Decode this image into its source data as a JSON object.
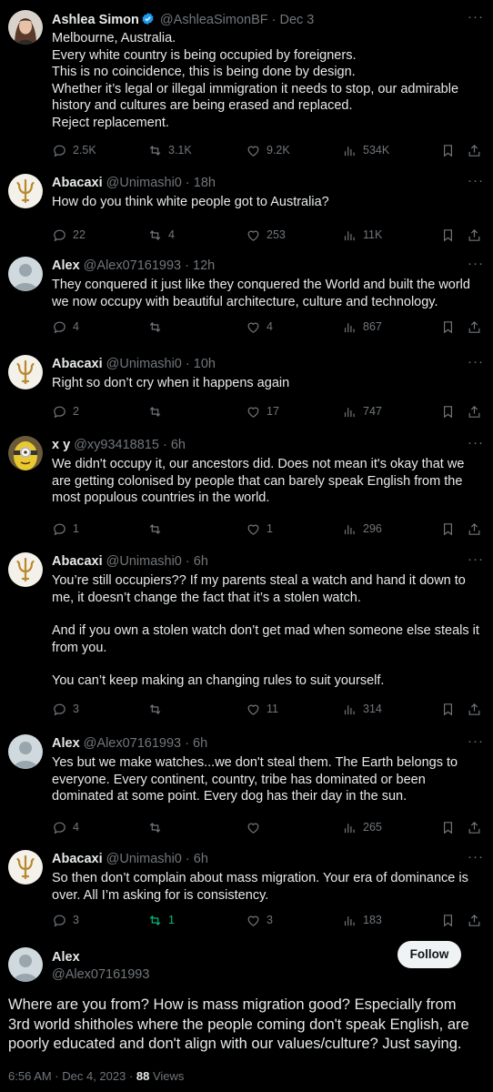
{
  "tweets": [
    {
      "name": "Ashlea Simon",
      "verified": true,
      "handle": "@AshleaSimonBF",
      "time": "· Dec 3",
      "avatar": "woman-photo",
      "paragraphs": [
        "Melbourne, Australia.",
        "Every white country is being occupied by foreigners.",
        "This is no coincidence, this is being done by design.",
        "Whether it’s legal or illegal immigration it needs to stop, our admirable history and cultures are being erased and replaced.",
        "Reject replacement."
      ],
      "replies": "2.5K",
      "retweets": "3.1K",
      "likes": "9.2K",
      "views": "534K"
    },
    {
      "name": "Abacaxi",
      "handle": "@Unimashi0",
      "time": "· 18h",
      "avatar": "trident",
      "paragraphs": [
        "How do you think white people got to Australia?"
      ],
      "replies": "22",
      "retweets": "4",
      "likes": "253",
      "views": "11K"
    },
    {
      "name": "Alex",
      "handle": "@Alex07161993",
      "time": "· 12h",
      "avatar": "default",
      "paragraphs": [
        "They conquered it just like they conquered the World and built the world we now occupy with beautiful architecture, culture and technology."
      ],
      "replies": "4",
      "retweets": "",
      "likes": "4",
      "views": "867"
    },
    {
      "name": "Abacaxi",
      "handle": "@Unimashi0",
      "time": "· 10h",
      "avatar": "trident",
      "paragraphs": [
        "Right so don’t cry when it happens again"
      ],
      "replies": "2",
      "retweets": "",
      "likes": "17",
      "views": "747"
    },
    {
      "name": "x y",
      "handle": "@xy93418815",
      "time": "· 6h",
      "avatar": "minion",
      "paragraphs": [
        "We didn't occupy it, our ancestors did. Does not mean it's okay that we are getting colonised by people that can barely speak English from the most populous countries in the world."
      ],
      "replies": "1",
      "retweets": "",
      "likes": "1",
      "views": "296"
    },
    {
      "name": "Abacaxi",
      "handle": "@Unimashi0",
      "time": "· 6h",
      "avatar": "trident",
      "paragraphs": [
        "You’re still occupiers?? If my parents steal a watch and hand it down to me, it doesn’t change the fact that it’s a stolen watch.",
        "And if you own a stolen watch don’t get mad when someone else steals it from you.",
        "You can’t keep making an changing rules to suit yourself."
      ],
      "replies": "3",
      "retweets": "",
      "likes": "11",
      "views": "314"
    },
    {
      "name": "Alex",
      "handle": "@Alex07161993",
      "time": "· 6h",
      "avatar": "default",
      "paragraphs": [
        "Yes but we make watches...we don't steal them.  The Earth belongs to everyone.  Every continent, country, tribe has dominated or been dominated at some point.  Every dog has their day in the sun."
      ],
      "replies": "4",
      "retweets": "",
      "likes": "",
      "views": "265"
    },
    {
      "name": "Abacaxi",
      "handle": "@Unimashi0",
      "time": "· 6h",
      "avatar": "trident",
      "paragraphs": [
        "So then don’t complain about mass migration. Your era of dominance is over. All I’m asking for is consistency."
      ],
      "replies": "3",
      "retweets": "1",
      "retweeted": true,
      "likes": "3",
      "views": "183"
    }
  ],
  "main": {
    "name": "Alex",
    "handle": "@Alex07161993",
    "follow_label": "Follow",
    "text": "Where are you from?  How is mass migration good?  Especially from 3rd world shitholes where the people coming don't speak English, are poorly educated and don't align with our values/culture?  Just saying.",
    "timestamp": "6:56 AM · Dec 4, 2023 · ",
    "views_count": "88",
    "views_label": " Views"
  },
  "colors": {
    "bg": "#000000",
    "text": "#e7e9ea",
    "muted": "#71767b",
    "verified": "#1d9bf0",
    "retweet_active": "#00ba7c"
  }
}
